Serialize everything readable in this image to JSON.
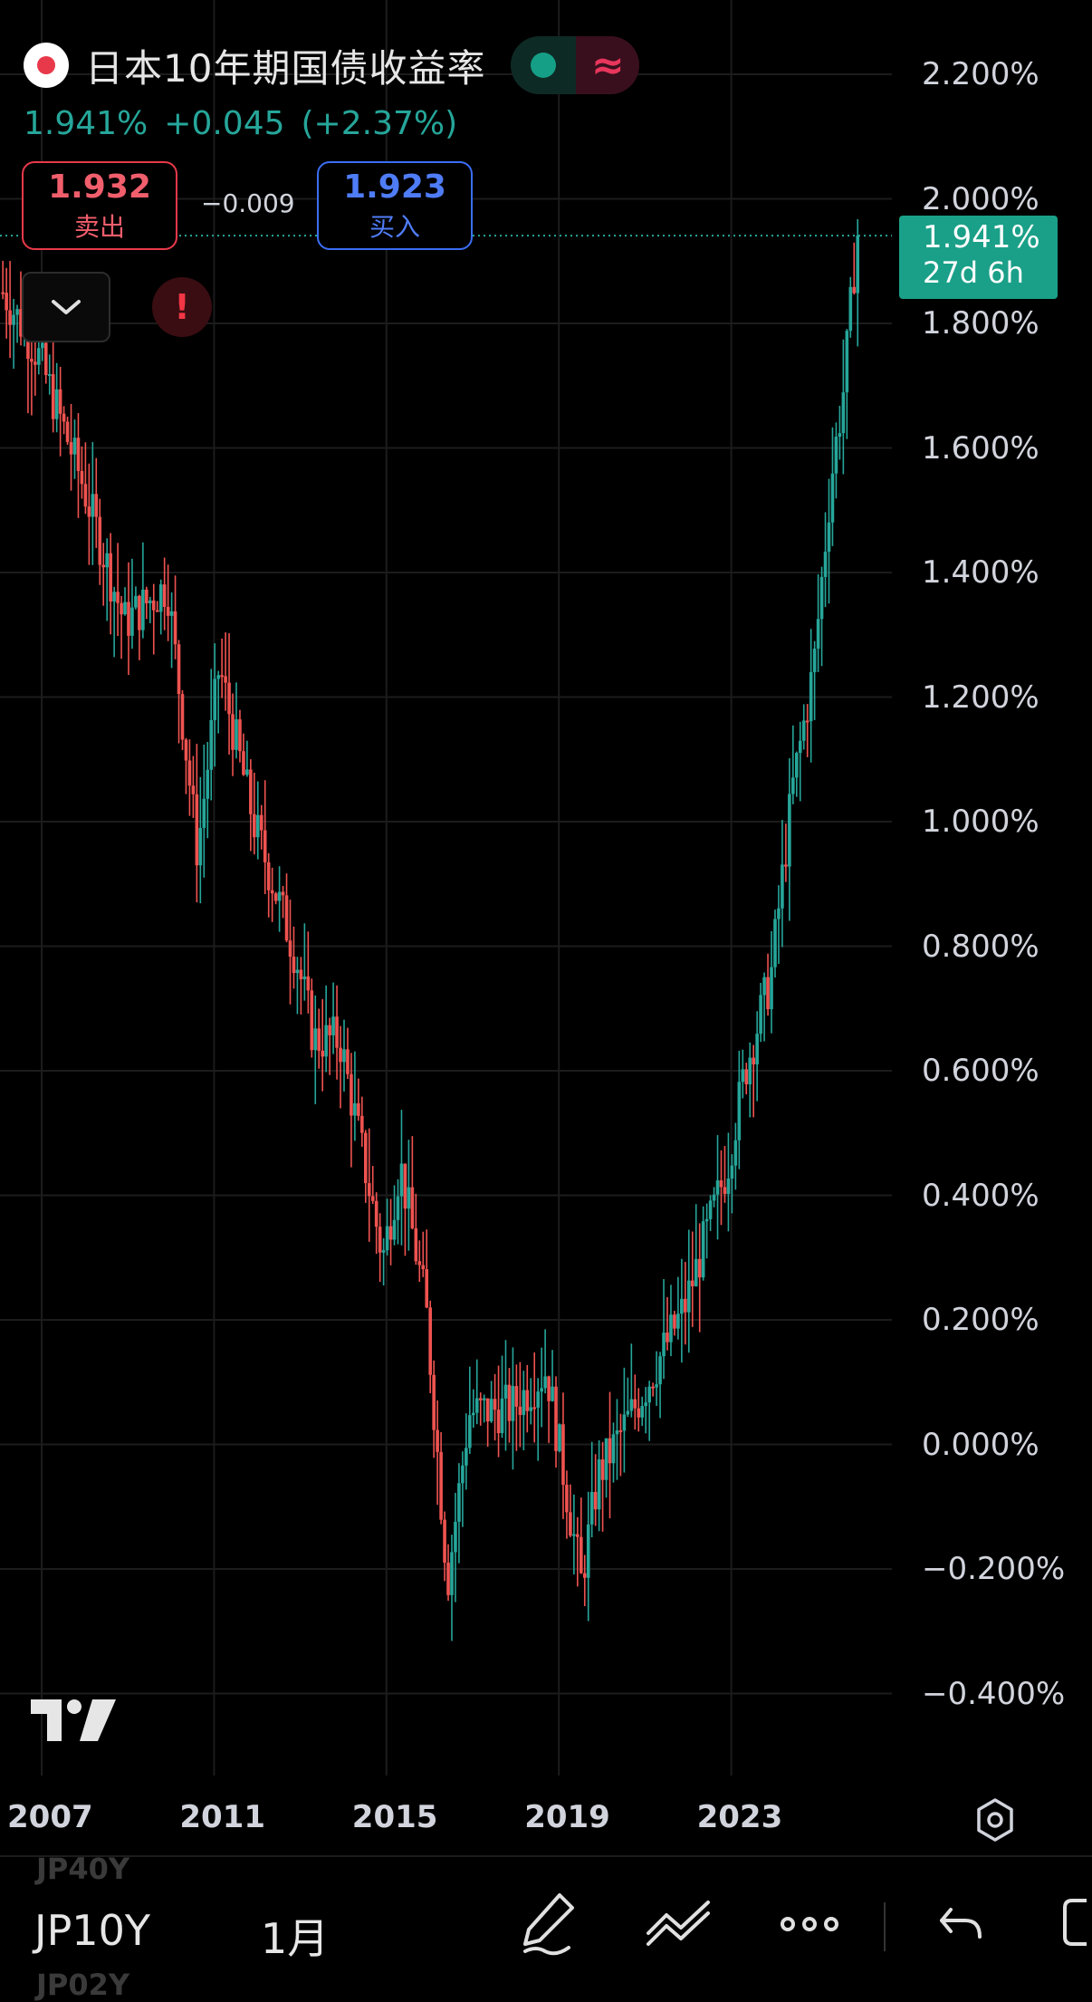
{
  "header": {
    "title": "日本10年期国债收益率",
    "price": "1.941%",
    "change": "+0.045",
    "change_pct": "(+2.37%)",
    "status_glyph": "≈"
  },
  "trade": {
    "sell_price": "1.932",
    "sell_label": "卖出",
    "spread": "−0.009",
    "buy_price": "1.923",
    "buy_label": "买入",
    "alert_glyph": "!"
  },
  "price_tag": {
    "value": "1.941%",
    "countdown": "27d 6h"
  },
  "y_axis_labels": [
    "2.200%",
    "2.000%",
    "1.800%",
    "1.600%",
    "1.400%",
    "1.200%",
    "1.000%",
    "0.800%",
    "0.600%",
    "0.400%",
    "0.200%",
    "0.000%",
    "−0.200%",
    "−0.400%"
  ],
  "x_axis_labels": [
    "2007",
    "2011",
    "2015",
    "2019",
    "2023"
  ],
  "toolbar": {
    "symbol": "JP10Y",
    "interval": "1月",
    "ghost_prev": "JP40Y",
    "ghost_next": "JP02Y"
  },
  "colors": {
    "up": "#26a69a",
    "down": "#ef5350",
    "price_tag": "#1aa088",
    "background": "#000000"
  },
  "chart_data": {
    "type": "candlestick",
    "interval": "1 month",
    "ylim": [
      -0.4,
      2.2
    ],
    "y_unit": "%",
    "last_price": 1.941,
    "anchors": [
      {
        "t": 2006.2,
        "y": 1.85
      },
      {
        "t": 2007.0,
        "y": 1.75
      },
      {
        "t": 2008.0,
        "y": 1.55
      },
      {
        "t": 2009.0,
        "y": 1.32
      },
      {
        "t": 2010.0,
        "y": 1.38
      },
      {
        "t": 2010.7,
        "y": 0.95
      },
      {
        "t": 2011.2,
        "y": 1.25
      },
      {
        "t": 2012.0,
        "y": 1.0
      },
      {
        "t": 2013.0,
        "y": 0.78
      },
      {
        "t": 2013.4,
        "y": 0.65
      },
      {
        "t": 2014.0,
        "y": 0.65
      },
      {
        "t": 2015.0,
        "y": 0.3
      },
      {
        "t": 2015.4,
        "y": 0.45
      },
      {
        "t": 2016.0,
        "y": 0.22
      },
      {
        "t": 2016.5,
        "y": -0.22
      },
      {
        "t": 2017.0,
        "y": 0.05
      },
      {
        "t": 2018.0,
        "y": 0.06
      },
      {
        "t": 2018.8,
        "y": 0.12
      },
      {
        "t": 2019.6,
        "y": -0.22
      },
      {
        "t": 2020.0,
        "y": -0.05
      },
      {
        "t": 2021.0,
        "y": 0.08
      },
      {
        "t": 2022.0,
        "y": 0.22
      },
      {
        "t": 2023.0,
        "y": 0.45
      },
      {
        "t": 2023.4,
        "y": 0.6
      },
      {
        "t": 2024.0,
        "y": 0.75
      },
      {
        "t": 2024.5,
        "y": 1.05
      },
      {
        "t": 2025.0,
        "y": 1.25
      },
      {
        "t": 2025.4,
        "y": 1.55
      },
      {
        "t": 2025.7,
        "y": 1.7
      },
      {
        "t": 2026.0,
        "y": 1.941
      }
    ]
  }
}
